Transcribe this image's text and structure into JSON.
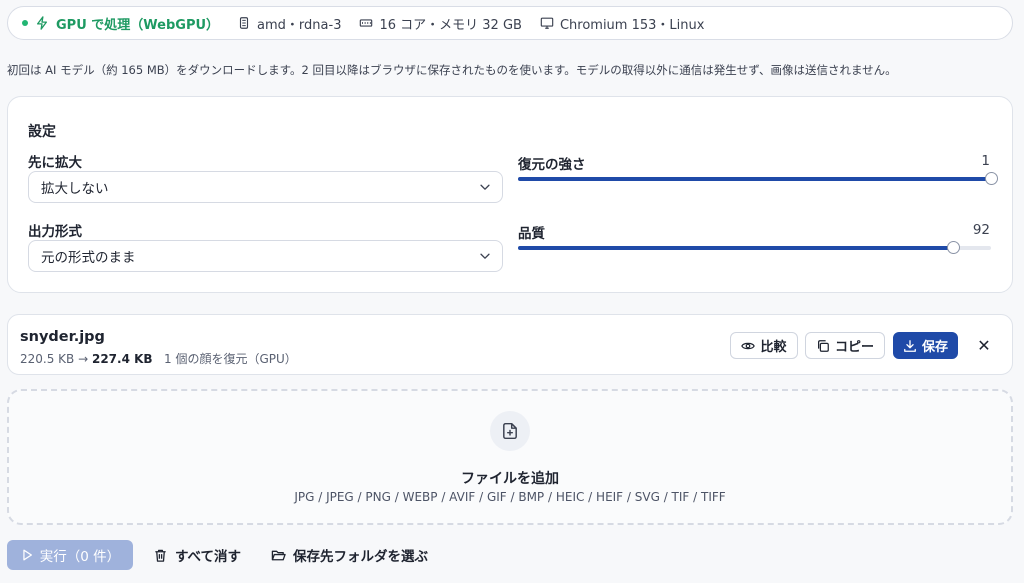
{
  "status": {
    "gpu_label": "GPU で処理（WebGPU）",
    "adapter": "amd・rdna-3",
    "hardware": "16 コア・メモリ 32 GB",
    "browser": "Chromium 153・Linux",
    "gpu_color": "#1e9a62"
  },
  "notice": "初回は AI モデル（約 165 MB）をダウンロードします。2 回目以降はブラウザに保存されたものを使います。モデルの取得以外に通信は発生せず、画像は送信されません。",
  "settings": {
    "title": "設定",
    "upscale": {
      "label": "先に拡大",
      "value": "拡大しない"
    },
    "format": {
      "label": "出力形式",
      "value": "元の形式のまま"
    },
    "strength": {
      "label": "復元の強さ",
      "value": "1",
      "fraction": 1.0
    },
    "quality": {
      "label": "品質",
      "value": "92",
      "fraction": 0.92
    }
  },
  "file": {
    "name": "snyder.jpg",
    "size_from": "220.5 KB →",
    "size_to": "227.4 KB",
    "detail": "1 個の顔を復元（GPU）",
    "compare_label": "比較",
    "copy_label": "コピー",
    "save_label": "保存",
    "close_glyph": "✕"
  },
  "dropzone": {
    "title": "ファイルを追加",
    "formats": "JPG / JPEG / PNG / WEBP / AVIF / GIF / BMP / HEIC / HEIF / SVG / TIF / TIFF"
  },
  "footer": {
    "run_label": "実行（0 件）",
    "clear_label": "すべて消す",
    "folder_label": "保存先フォルダを選ぶ"
  },
  "colors": {
    "accent": "#1f4aa8",
    "run_disabled": "#9fb2dc"
  }
}
